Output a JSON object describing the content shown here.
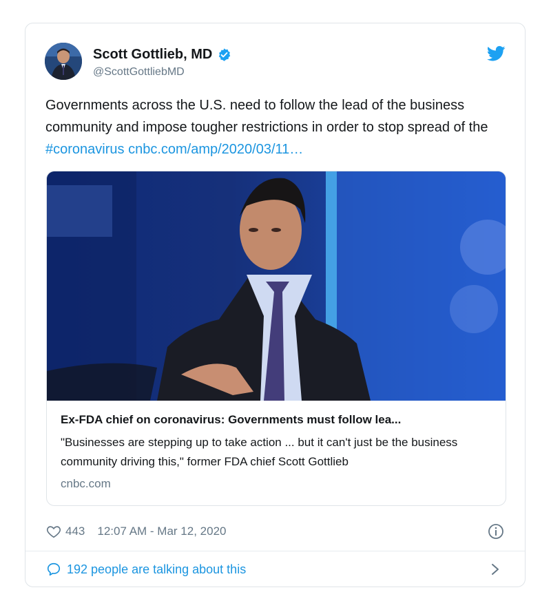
{
  "tweet": {
    "author": {
      "name": "Scott Gottlieb, MD",
      "handle": "@ScottGottliebMD",
      "verified": true
    },
    "text_parts": {
      "body": "Governments across the U.S. need to follow the lead of the business community and impose tougher restrictions in order to stop spread of the ",
      "hashtag": "#coronavirus",
      "link": "cnbc.com/amp/2020/03/11…"
    },
    "link_card": {
      "headline": "Ex-FDA chief on coronavirus: Governments must follow lea...",
      "description": "\"Businesses are stepping up to take action ... but it can't just be the business community driving this,\" former FDA chief Scott Gottlieb",
      "domain": "cnbc.com"
    },
    "likes": "443",
    "timestamp": "12:07 AM - Mar 12, 2020",
    "talking": "192 people are talking about this"
  },
  "icons": {
    "verified": "verified-badge-icon",
    "brand": "twitter-bird-icon",
    "like": "heart-icon",
    "info": "info-icon",
    "replies": "speech-bubble-icon",
    "more": "chevron-right-icon"
  },
  "colors": {
    "link": "#1b95e0",
    "muted": "#657786",
    "text": "#14171a",
    "border": "#dfe4e8"
  }
}
